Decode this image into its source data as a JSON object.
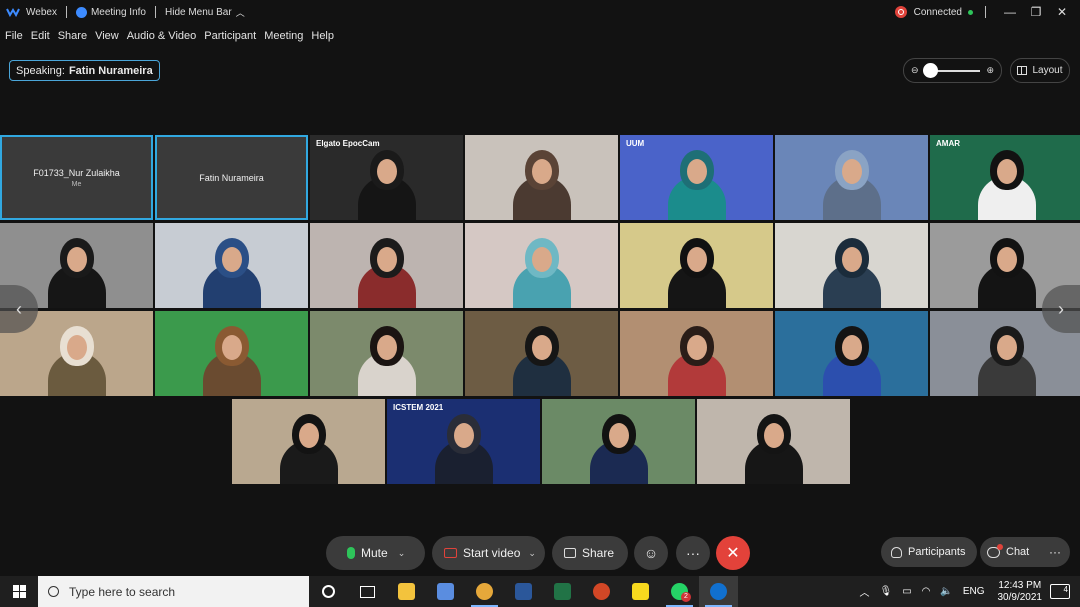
{
  "titlebar": {
    "app_name": "Webex",
    "meeting_info": "Meeting Info",
    "hide_menu_bar": "Hide Menu Bar",
    "status": "Connected",
    "minimize": "—",
    "restore": "❐",
    "close": "✕"
  },
  "menu": [
    "File",
    "Edit",
    "Share",
    "View",
    "Audio & Video",
    "Participant",
    "Meeting",
    "Help"
  ],
  "speaking": {
    "prefix": "Speaking:",
    "name": "Fatin Nurameira"
  },
  "zoom": {
    "level_fraction": 0.0
  },
  "layout_label": "Layout",
  "participants_tiles": [
    {
      "name": "F01733_Nur Zulaikha",
      "sub": "Me",
      "camera": false,
      "selected": true
    },
    {
      "name": "Fatin Nurameira",
      "camera": false,
      "selected": true
    },
    {
      "label": "Elgato EpocCam",
      "bg": "#2a2a2a",
      "head": "#1a1a1a",
      "body": "#151515"
    },
    {
      "bg": "#c9c2bb",
      "head": "#5a4336",
      "body": "#4b3a31"
    },
    {
      "label": "UUM",
      "bg": "#4a63c9",
      "head": "#1e6f76",
      "body": "#1b8c8c"
    },
    {
      "bg": "#6a86b8",
      "head": "#8aa3c4",
      "body": "#5d6f8a"
    },
    {
      "label": "AMAR",
      "bg": "#1f6b4b",
      "head": "#121212",
      "body": "#efefef"
    },
    {
      "bg": "#8f8f8f",
      "head": "#1a1a1a",
      "body": "#161616"
    },
    {
      "bg": "#c7ccd3",
      "head": "#2b4f86",
      "body": "#223f70"
    },
    {
      "bg": "#bdb4b0",
      "head": "#1c1b1b",
      "body": "#8a2c2c"
    },
    {
      "bg": "#d5c8c4",
      "head": "#6fb8c4",
      "body": "#49a2b0"
    },
    {
      "bg": "#d6c98a",
      "head": "#111111",
      "body": "#151515"
    },
    {
      "bg": "#d8d6d0",
      "head": "#1b2c3b",
      "body": "#2a3e52"
    },
    {
      "bg": "#9b9b9b",
      "head": "#121212",
      "body": "#141414"
    },
    {
      "bg": "#bba68b",
      "head": "#e8dfd2",
      "body": "#6b5b3f"
    },
    {
      "bg": "#3b9a4c",
      "head": "#8a5a32",
      "body": "#6a4b30"
    },
    {
      "bg": "#7c8a6c",
      "head": "#1b1412",
      "body": "#d9d3cc"
    },
    {
      "bg": "#6d5c44",
      "head": "#161616",
      "body": "#1f2f40"
    },
    {
      "bg": "#b28f72",
      "head": "#2a1d18",
      "body": "#b23a3a"
    },
    {
      "bg": "#2b6f9c",
      "head": "#141414",
      "body": "#2c4fae"
    },
    {
      "bg": "#8a8f98",
      "head": "#1a1a1a",
      "body": "#3a3a3a"
    },
    {
      "bg": "#b9a890",
      "head": "#131313",
      "body": "#1a1a1a"
    },
    {
      "label": "ICSTEM 2021",
      "bg": "#1b2f72",
      "head": "#2a2d38",
      "body": "#1a2030"
    },
    {
      "bg": "#6b8a66",
      "head": "#121212",
      "body": "#1b2a52"
    },
    {
      "bg": "#bfb6ac",
      "head": "#141414",
      "body": "#161616"
    }
  ],
  "controls": {
    "mute": "Mute",
    "start_video": "Start video",
    "share": "Share",
    "reactions_icon": "☺",
    "more_icon": "···",
    "end_icon": "✕",
    "participants": "Participants",
    "chat": "Chat",
    "more_right_icon": "···",
    "nav_left": "‹",
    "nav_right": "›"
  },
  "taskbar": {
    "search_placeholder": "Type here to search",
    "whatsapp_badge": "2",
    "lang": "ENG",
    "time": "12:43 PM",
    "date": "30/9/2021",
    "notifications": "4"
  },
  "colors": {
    "accent": "#31a8e0",
    "end_call": "#e3423a",
    "mic_on": "#2ec45a",
    "video_off": "#e0433b"
  }
}
